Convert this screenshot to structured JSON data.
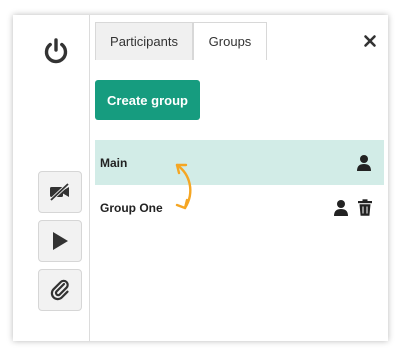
{
  "tabs": [
    {
      "label": "Participants",
      "active": false
    },
    {
      "label": "Groups",
      "active": true
    }
  ],
  "close_icon": "close-icon",
  "create_button": {
    "label": "Create group",
    "color": "#169c7f"
  },
  "groups": [
    {
      "name": "Main",
      "selected": true,
      "icons": [
        "user-icon"
      ]
    },
    {
      "name": "Group One",
      "selected": false,
      "icons": [
        "user-icon",
        "trash-icon"
      ]
    }
  ],
  "rail": {
    "top_icon": "power-icon",
    "buttons": [
      "video-off-icon",
      "play-icon",
      "paperclip-icon"
    ]
  },
  "colors": {
    "selected_row": "#d2ece7",
    "annotation_arrow": "#f5a623"
  }
}
